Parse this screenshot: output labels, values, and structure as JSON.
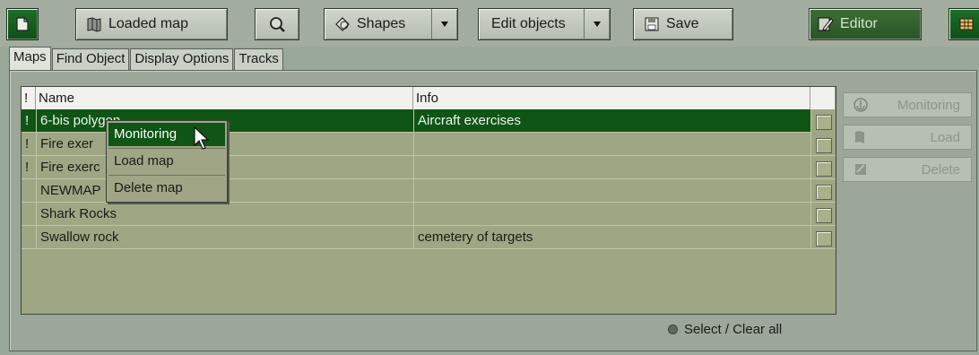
{
  "toolbar": {
    "loaded_map_label": "Loaded map",
    "shapes_label": "Shapes",
    "edit_objects_label": "Edit objects",
    "save_label": "Save",
    "editor_label": "Editor"
  },
  "tabs": [
    {
      "label": "Maps"
    },
    {
      "label": "Find Object"
    },
    {
      "label": "Display Options"
    },
    {
      "label": "Tracks"
    }
  ],
  "table": {
    "headers": {
      "mark": "!",
      "name": "Name",
      "info": "Info"
    },
    "rows": [
      {
        "mark": "!",
        "name": "6-bis polygon",
        "info": "Aircraft exercises"
      },
      {
        "mark": "!",
        "name": "Fire exer",
        "info": ""
      },
      {
        "mark": "!",
        "name": "Fire exerc",
        "info": ""
      },
      {
        "mark": "",
        "name": "NEWMAP",
        "info": ""
      },
      {
        "mark": "",
        "name": "Shark Rocks",
        "info": ""
      },
      {
        "mark": "",
        "name": "Swallow rock",
        "info": "cemetery of targets"
      }
    ]
  },
  "context_menu": {
    "items": [
      {
        "label": "Monitoring"
      },
      {
        "label": "Load map"
      },
      {
        "label": "Delete map"
      }
    ]
  },
  "side_buttons": {
    "monitoring": "Monitoring",
    "load": "Load",
    "delete": "Delete"
  },
  "status": {
    "select_clear_all": "Select / Clear all"
  },
  "colors": {
    "selection": "#0f5515",
    "grid_bg": "#9fa683",
    "accent_green": "#1e6e28"
  },
  "icons": [
    "new-map-icon",
    "loaded-map-icon",
    "zoom-icon",
    "shapes-icon",
    "chevron-down-icon",
    "save-icon",
    "editor-icon",
    "grid-icon",
    "anchor-icon",
    "load-icon",
    "delete-icon",
    "cursor-icon"
  ]
}
